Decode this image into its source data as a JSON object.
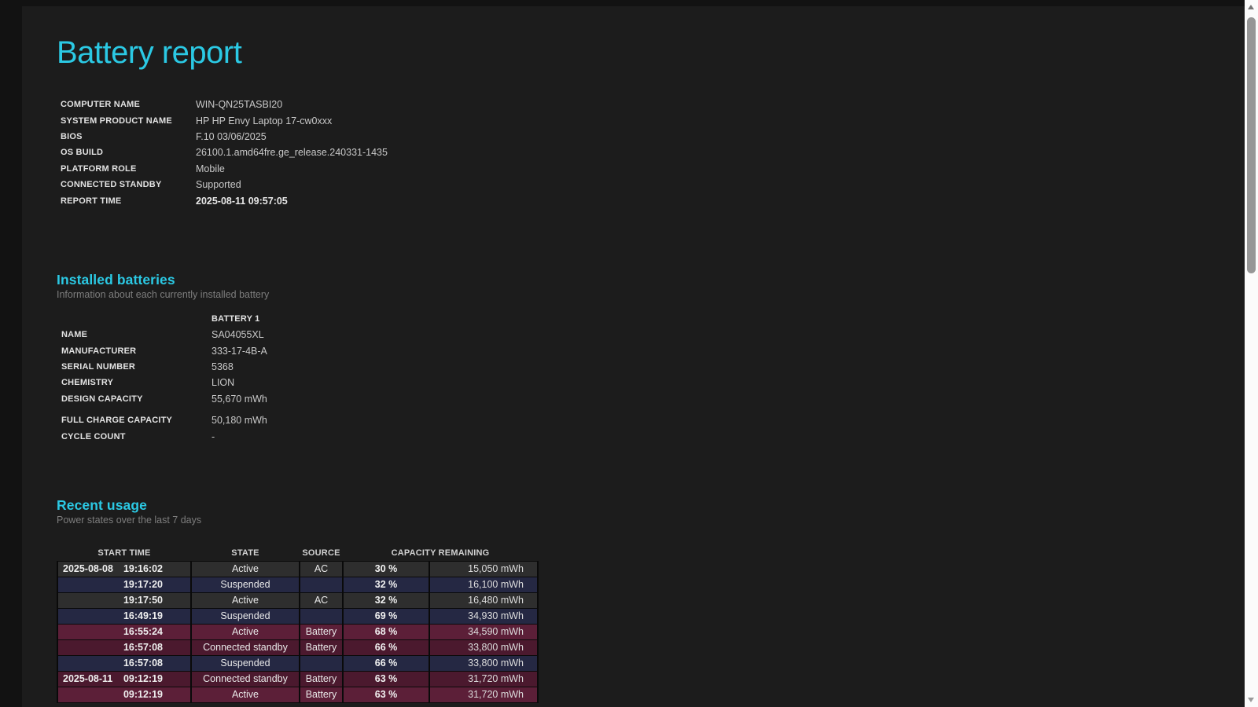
{
  "colors": {
    "accent_cyan": "#2bc9e4",
    "page_background": "#1c1c1c",
    "row_active_ac": "#2e2e2e",
    "row_suspended": "#252843",
    "row_active_battery": "#5c1f38",
    "row_connected_standby_battery": "#4b192e",
    "scrollbar_track": "#fbfbfb",
    "scrollbar_thumb": "#969696"
  },
  "icons": {
    "scroll_up": "triangle-up",
    "scroll_down": "triangle-down"
  },
  "header": {
    "title": "Battery report"
  },
  "system_info": {
    "rows": [
      {
        "label": "COMPUTER NAME",
        "value": "WIN-QN25TASBI20"
      },
      {
        "label": "SYSTEM PRODUCT NAME",
        "value": "HP HP Envy Laptop 17-cw0xxx"
      },
      {
        "label": "BIOS",
        "value": "F.10 03/06/2025"
      },
      {
        "label": "OS BUILD",
        "value": "26100.1.amd64fre.ge_release.240331-1435"
      },
      {
        "label": "PLATFORM ROLE",
        "value": "Mobile"
      },
      {
        "label": "CONNECTED STANDBY",
        "value": "Supported"
      },
      {
        "label": "REPORT TIME",
        "value": "2025-08-11  09:57:05"
      }
    ]
  },
  "installed_batteries": {
    "heading": "Installed batteries",
    "subtitle": "Information about each currently installed battery",
    "column_header": "BATTERY 1",
    "rows": [
      {
        "label": "NAME",
        "value": "SA04055XL"
      },
      {
        "label": "MANUFACTURER",
        "value": "333-17-4B-A"
      },
      {
        "label": "SERIAL NUMBER",
        "value": "5368"
      },
      {
        "label": "CHEMISTRY",
        "value": "LION"
      },
      {
        "label": "DESIGN CAPACITY",
        "value": "55,670 mWh"
      },
      {
        "label": "FULL CHARGE CAPACITY",
        "value": "50,180 mWh"
      },
      {
        "label": "CYCLE COUNT",
        "value": "-"
      }
    ]
  },
  "recent_usage": {
    "heading": "Recent usage",
    "subtitle": "Power states over the last 7 days",
    "columns": {
      "start_time": "START TIME",
      "state": "STATE",
      "source": "SOURCE",
      "capacity_remaining": "CAPACITY REMAINING"
    },
    "rows": [
      {
        "date": "2025-08-08",
        "time": "19:16:02",
        "state": "Active",
        "source": "AC",
        "percent": "30 %",
        "mwh": "15,050 mWh",
        "color": "#2e2e2e"
      },
      {
        "date": "",
        "time": "19:17:20",
        "state": "Suspended",
        "source": "",
        "percent": "32 %",
        "mwh": "16,100 mWh",
        "color": "#252843"
      },
      {
        "date": "",
        "time": "19:17:50",
        "state": "Active",
        "source": "AC",
        "percent": "32 %",
        "mwh": "16,480 mWh",
        "color": "#2e2e2e"
      },
      {
        "date": "",
        "time": "16:49:19",
        "state": "Suspended",
        "source": "",
        "percent": "69 %",
        "mwh": "34,930 mWh",
        "color": "#252843"
      },
      {
        "date": "",
        "time": "16:55:24",
        "state": "Active",
        "source": "Battery",
        "percent": "68 %",
        "mwh": "34,590 mWh",
        "color": "#5c1f38"
      },
      {
        "date": "",
        "time": "16:57:08",
        "state": "Connected standby",
        "source": "Battery",
        "percent": "66 %",
        "mwh": "33,800 mWh",
        "color": "#4b192e"
      },
      {
        "date": "",
        "time": "16:57:08",
        "state": "Suspended",
        "source": "",
        "percent": "66 %",
        "mwh": "33,800 mWh",
        "color": "#252843"
      },
      {
        "date": "2025-08-11",
        "time": "09:12:19",
        "state": "Connected standby",
        "source": "Battery",
        "percent": "63 %",
        "mwh": "31,720 mWh",
        "color": "#4b192e"
      },
      {
        "date": "",
        "time": "09:12:19",
        "state": "Active",
        "source": "Battery",
        "percent": "63 %",
        "mwh": "31,720 mWh",
        "color": "#5c1f38"
      }
    ]
  }
}
